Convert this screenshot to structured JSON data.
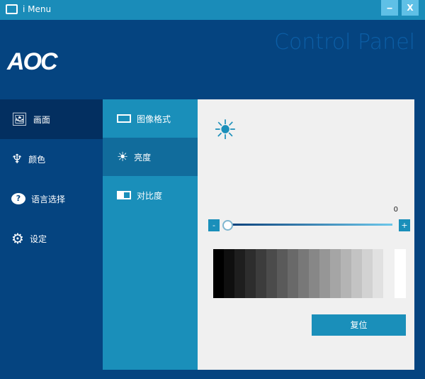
{
  "window": {
    "title": "i Menu",
    "minimize": "‒",
    "close": "X"
  },
  "header": {
    "brand": "AOC",
    "panel_title": "Control Panel"
  },
  "sidebar": {
    "items": [
      {
        "label": "画面",
        "icon": "picture-icon"
      },
      {
        "label": "颜色",
        "icon": "brush-icon"
      },
      {
        "label": "语言选择",
        "icon": "help-bubble-icon"
      },
      {
        "label": "设定",
        "icon": "gear-icon"
      }
    ],
    "selected": 0
  },
  "submenu": {
    "items": [
      {
        "label": "图像格式",
        "icon": "aspect-icon"
      },
      {
        "label": "亮度",
        "icon": "sun-icon"
      },
      {
        "label": "对比度",
        "icon": "contrast-icon"
      }
    ],
    "selected": 1
  },
  "brightness": {
    "value": "0",
    "min_label": "-",
    "max_label": "+",
    "fraction": 0,
    "reset_label": "复位"
  },
  "grayscale": [
    "#000000",
    "#0f0f0f",
    "#1e1e1e",
    "#2d2d2d",
    "#3c3c3c",
    "#4b4b4b",
    "#5a5a5a",
    "#696969",
    "#787878",
    "#878787",
    "#969696",
    "#a5a5a5",
    "#b4b4b4",
    "#c3c3c3",
    "#d2d2d2",
    "#e1e1e1"
  ]
}
